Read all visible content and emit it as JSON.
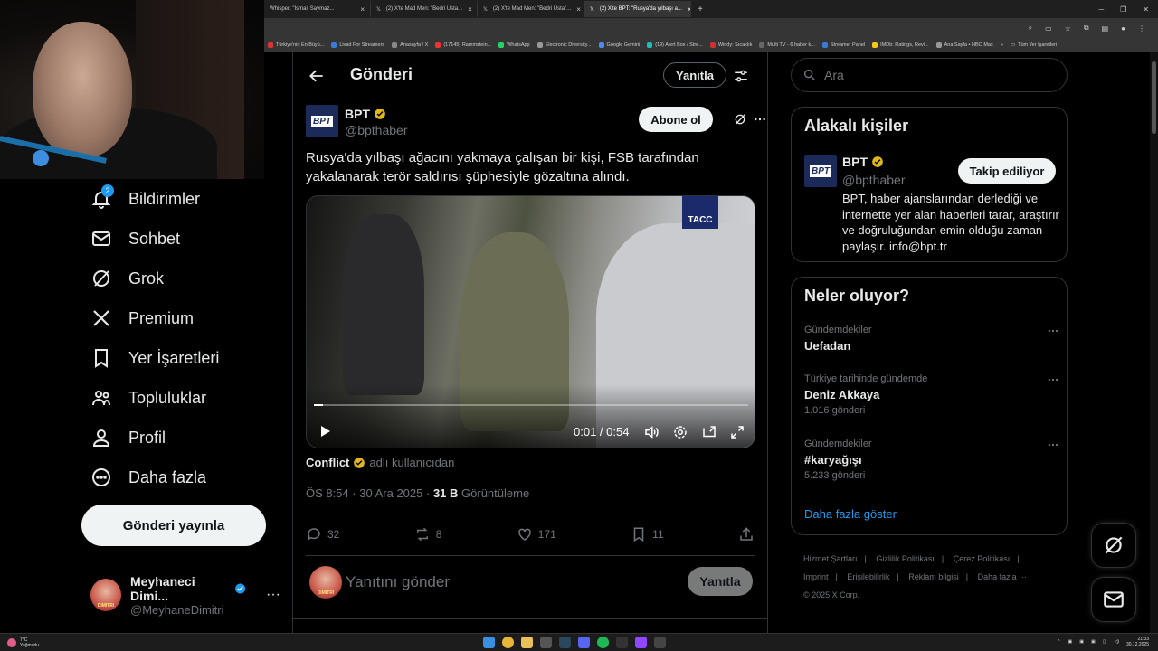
{
  "browser": {
    "tabs": [
      {
        "label": "Whisper: \"İsmail Saymaz...",
        "active": false
      },
      {
        "label": "(2) X'te Mad Men: \"Bedri Usta...",
        "active": false
      },
      {
        "label": "(2) X'te Mad Men: \"Bedri Usta\"...",
        "active": false
      },
      {
        "label": "(2) X'te BPT: \"Rusya'da yılbaşı a...",
        "active": true
      }
    ],
    "bookmarks": [
      {
        "label": "Türkiye'nin En Büyü...",
        "color": "#d33"
      },
      {
        "label": "Livad For Streamers",
        "color": "#3b7bd8"
      },
      {
        "label": "Anasayfa / X",
        "color": "#888"
      },
      {
        "label": "(17145) Rammstein...",
        "color": "#e33"
      },
      {
        "label": "WhatsApp",
        "color": "#25d366"
      },
      {
        "label": "Electronic Diversity...",
        "color": "#999"
      },
      {
        "label": "Google Gemini",
        "color": "#4a8cf0"
      },
      {
        "label": "(19) Alert Box / Stre...",
        "color": "#2bb"
      },
      {
        "label": "Windy: Sıcaklık",
        "color": "#c33"
      },
      {
        "label": "Multi TV - 6 haber k...",
        "color": "#666"
      },
      {
        "label": "Streamer Panel",
        "color": "#3b7bd8"
      },
      {
        "label": "IMDb: Ratings, Revi...",
        "color": "#f5c518"
      },
      {
        "label": "Ana Sayfa • HBO Max",
        "color": "#999"
      }
    ],
    "all_bookmarks": "Tüm Yer İşaretleri"
  },
  "nav": {
    "notifications_badge": "2",
    "items": [
      {
        "label": "Bildirimler"
      },
      {
        "label": "Sohbet"
      },
      {
        "label": "Grok"
      },
      {
        "label": "Premium"
      },
      {
        "label": "Yer İşaretleri"
      },
      {
        "label": "Topluluklar"
      },
      {
        "label": "Profil"
      },
      {
        "label": "Daha fazla"
      }
    ],
    "post_button": "Gönderi yayınla"
  },
  "account": {
    "name": "Meyhaneci Dimi...",
    "handle": "@MeyhaneDimitri",
    "avatar_text": "DIMITRI"
  },
  "post": {
    "header_title": "Gönderi",
    "reply_top": "Yanıtla",
    "author_name": "BPT",
    "author_handle": "@bpthaber",
    "author_logo": "BPT",
    "subscribe": "Abone ol",
    "text": "Rusya'da yılbaşı ağacını yakmaya çalışan bir kişi, FSB tarafından yakalanarak terör saldırısı şüphesiyle gözaltına alındı.",
    "video": {
      "watermark": "TACC",
      "time": "0:01 / 0:54",
      "progress": 0.02
    },
    "attribution_name": "Conflict",
    "attribution_suffix": "adlı kullanıcıdan",
    "timestamp": "ÖS 8:54 · 30 Ara 2025 ·",
    "views_count": "31 B",
    "views_label": "Görüntüleme",
    "stats": {
      "replies": "32",
      "reposts": "8",
      "likes": "171",
      "bookmarks": "11"
    },
    "reply_placeholder": "Yanıtını gönder",
    "reply_button": "Yanıtla"
  },
  "sidebar": {
    "search_placeholder": "Ara",
    "related_title": "Alakalı kişiler",
    "related": {
      "name": "BPT",
      "handle": "@bpthaber",
      "follow_label": "Takip ediliyor",
      "bio": "BPT, haber ajanslarından derlediği ve internette yer alan haberleri tarar, araştırır ve doğruluğundan emin olduğu zaman paylaşır. info@bpt.tr"
    },
    "trends_title": "Neler oluyor?",
    "trends": [
      {
        "category": "Gündemdekiler",
        "name": "Uefadan",
        "count": ""
      },
      {
        "category": "Türkiye tarihinde gündemde",
        "name": "Deniz Akkaya",
        "count": "1.016 gönderi"
      },
      {
        "category": "Gündemdekiler",
        "name": "#karyağışı",
        "count": "5.233 gönderi"
      }
    ],
    "show_more": "Daha fazla göster",
    "footer_links": [
      "Hizmet Şartları",
      "|",
      "Gizlilik Politikası",
      "|",
      "Çerez Politikası",
      "|",
      "Imprint",
      "|",
      "Erişilebilirlik",
      "|",
      "Reklam bilgisi",
      "|",
      "Daha fazla ···"
    ],
    "copyright": "© 2025 X Corp."
  },
  "taskbar": {
    "weather_temp": "7°C",
    "weather_desc": "Yağmurlu",
    "time": "21:33",
    "date": "30.12.2025"
  },
  "colors": {
    "accent": "#1d9bf0",
    "verified_gold": "#e2b719",
    "bg": "#000000"
  }
}
